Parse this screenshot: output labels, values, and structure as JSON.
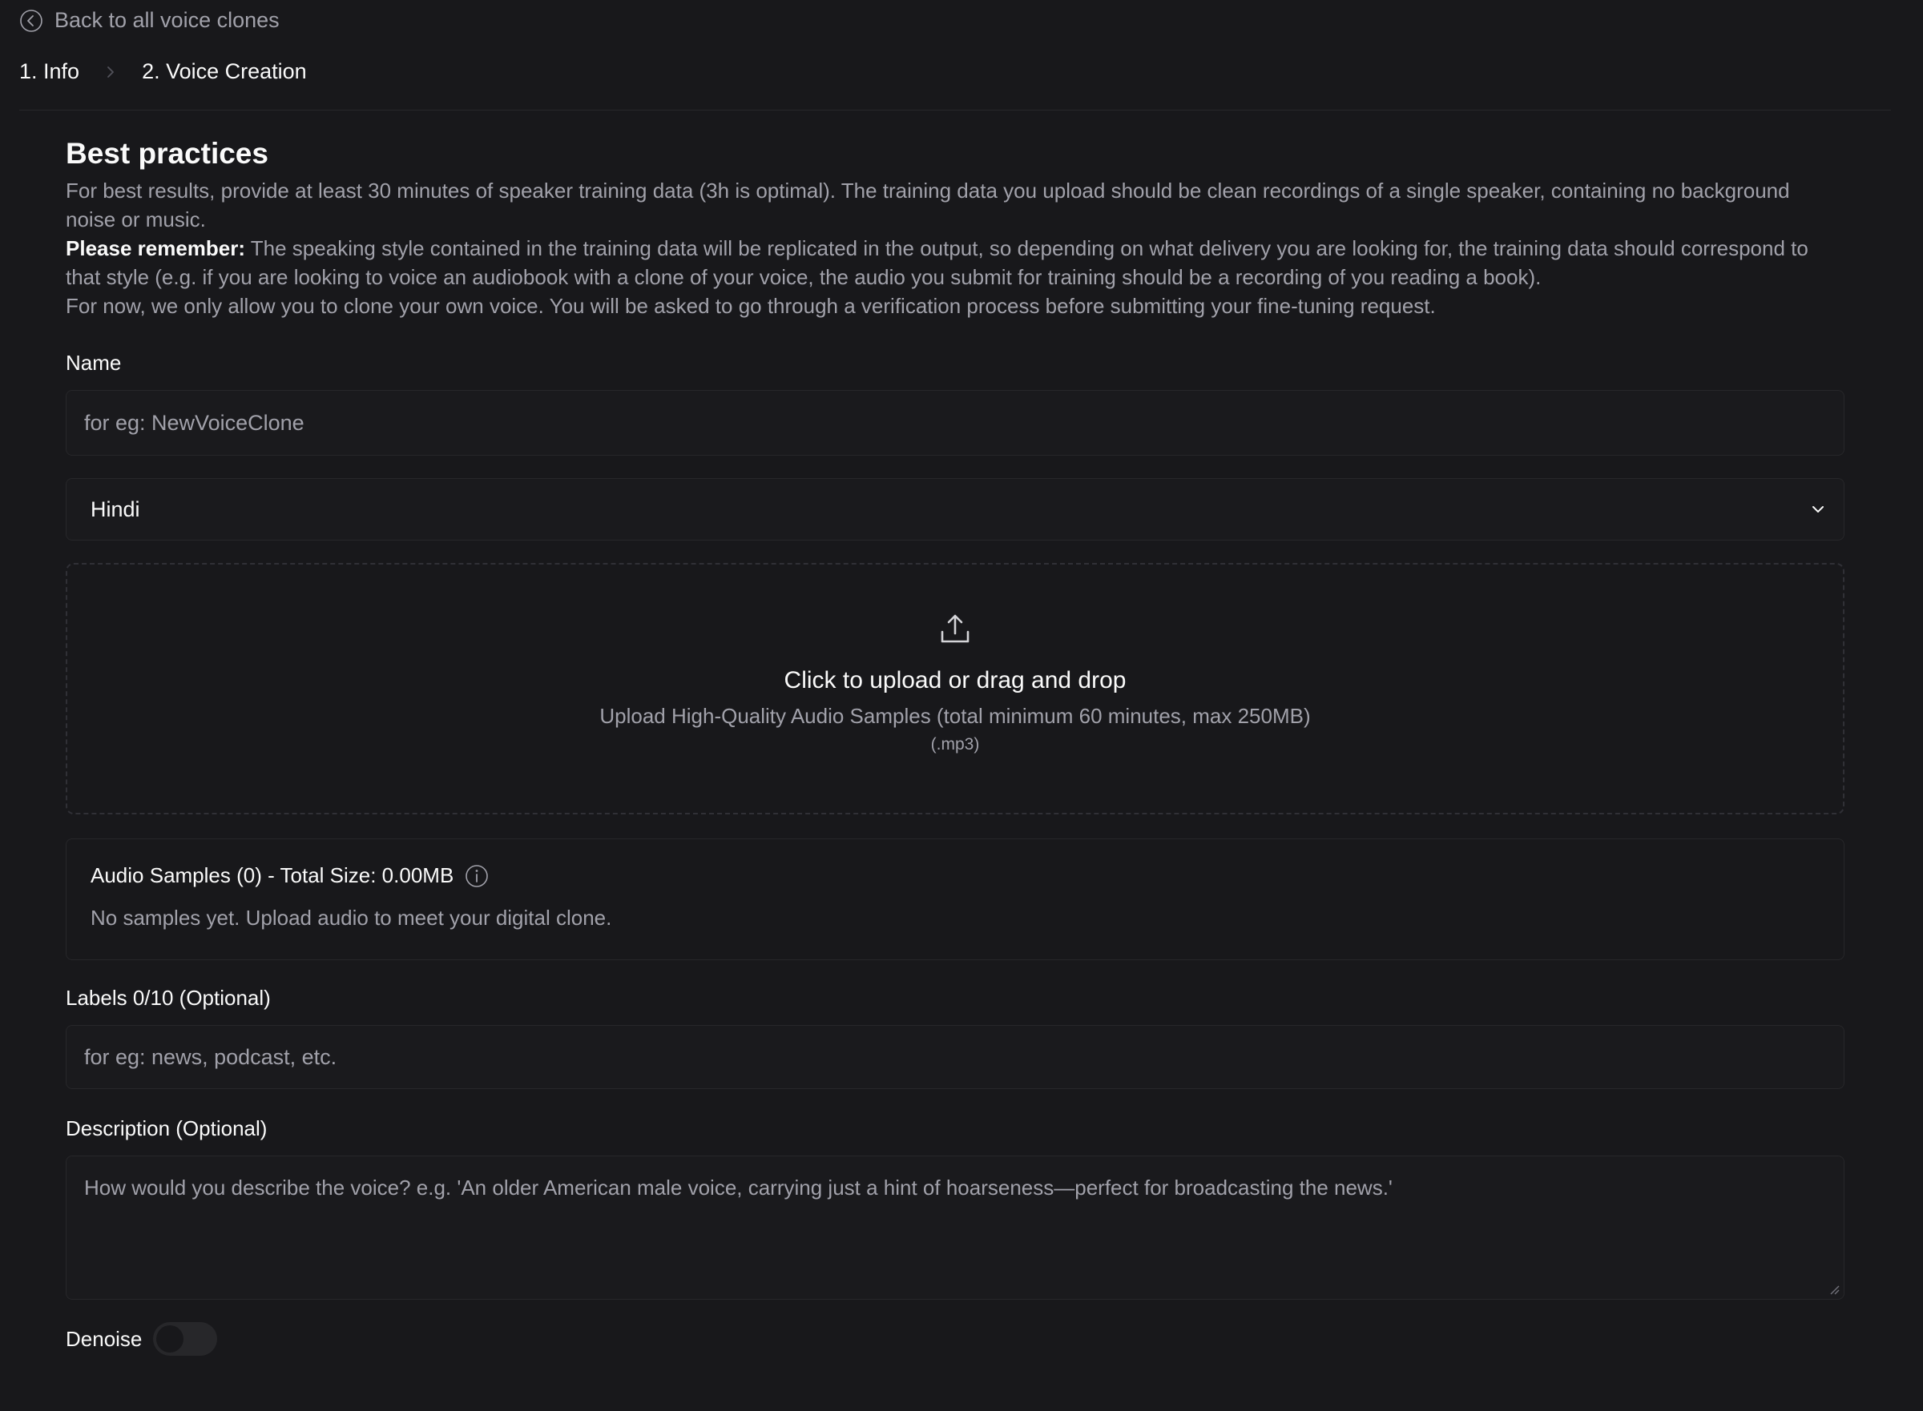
{
  "nav": {
    "back_label": "Back to all voice clones"
  },
  "steps": {
    "step1": "1. Info",
    "step2": "2. Voice Creation"
  },
  "best_practices": {
    "title": "Best practices",
    "para1": "For best results, provide at least 30 minutes of speaker training data (3h is optimal). The training data you upload should be clean recordings of a single speaker, containing no background noise or music.",
    "remember_bold": "Please remember:",
    "remember_text": " The speaking style contained in the training data will be replicated in the output, so depending on what delivery you are looking for, the training data should correspond to that style (e.g. if you are looking to voice an audiobook with a clone of your voice, the audio you submit for training should be a recording of you reading a book).",
    "remember_line2": "For now, we only allow you to clone your own voice. You will be asked to go through a verification process before submitting your fine-tuning request."
  },
  "form": {
    "name_label": "Name",
    "name_placeholder": "for eg: NewVoiceClone",
    "language_value": "Hindi",
    "upload_title": "Click to upload or drag and drop",
    "upload_subtitle": "Upload High-Quality Audio Samples (total minimum 60 minutes, max 250MB)",
    "upload_ext": "(.mp3)",
    "samples_header": "Audio Samples (0) - Total Size: 0.00MB",
    "samples_empty": "No samples yet. Upload audio to meet your digital clone.",
    "labels_label": "Labels 0/10 (Optional)",
    "labels_placeholder": "for eg: news, podcast, etc.",
    "description_label": "Description (Optional)",
    "description_placeholder": "How would you describe the voice? e.g. 'An older American male voice, carrying just a hint of hoarseness—perfect for broadcasting the news.'",
    "denoise_label": "Denoise",
    "denoise_on": false
  },
  "colors": {
    "background": "#18181b",
    "border": "#27272a",
    "text_primary": "#fafafa",
    "text_muted": "#a1a1aa"
  },
  "icons": {
    "back": "chevron-left-circle-icon",
    "step_separator": "chevron-right-icon",
    "select": "chevron-down-icon",
    "upload": "upload-icon",
    "info": "info-icon"
  }
}
